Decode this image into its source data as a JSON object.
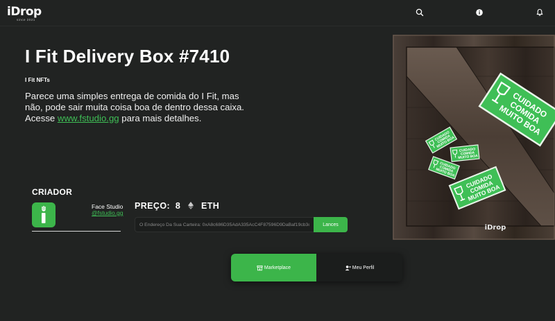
{
  "brand": {
    "logo_text": "iDrop",
    "logo_tagline": "since 2021"
  },
  "header": {
    "icons": [
      "search-icon",
      "info-icon",
      "bell-icon"
    ]
  },
  "nft": {
    "title": "I Fit Delivery Box #7410",
    "collection": "I Fit NFTs",
    "description_before": "Parece uma simples entrega de comida do I Fit, mas não, pode sair muita coisa boa de dentro dessa caixa. Acesse ",
    "description_link": "www.fstudio.gg",
    "description_after": " para mais detalhes."
  },
  "creator": {
    "label": "CRIADOR",
    "name": "Face Studio",
    "handle": "@fstudio.gg"
  },
  "price": {
    "label": "PREÇO:",
    "value": "8",
    "currency": "ETH"
  },
  "bid": {
    "placeholder": "O Endereço Da Sua Carteira: 0xA8c686D35AdA335AcC4F87596D9DaBaf19cb3c39",
    "button_label": "Lances"
  },
  "tabs": [
    {
      "label": "Marketplace",
      "icon": "store-icon",
      "active": true
    },
    {
      "label": "Meu Perfil",
      "icon": "user-icon",
      "active": false
    }
  ],
  "artwork": {
    "sticker_lines": [
      "CUIDADO",
      "COMIDA",
      "MUITO BOA"
    ],
    "watermark": "iDrop"
  },
  "colors": {
    "accent": "#3cb54a",
    "background": "#212322",
    "link": "#3fbf56"
  }
}
